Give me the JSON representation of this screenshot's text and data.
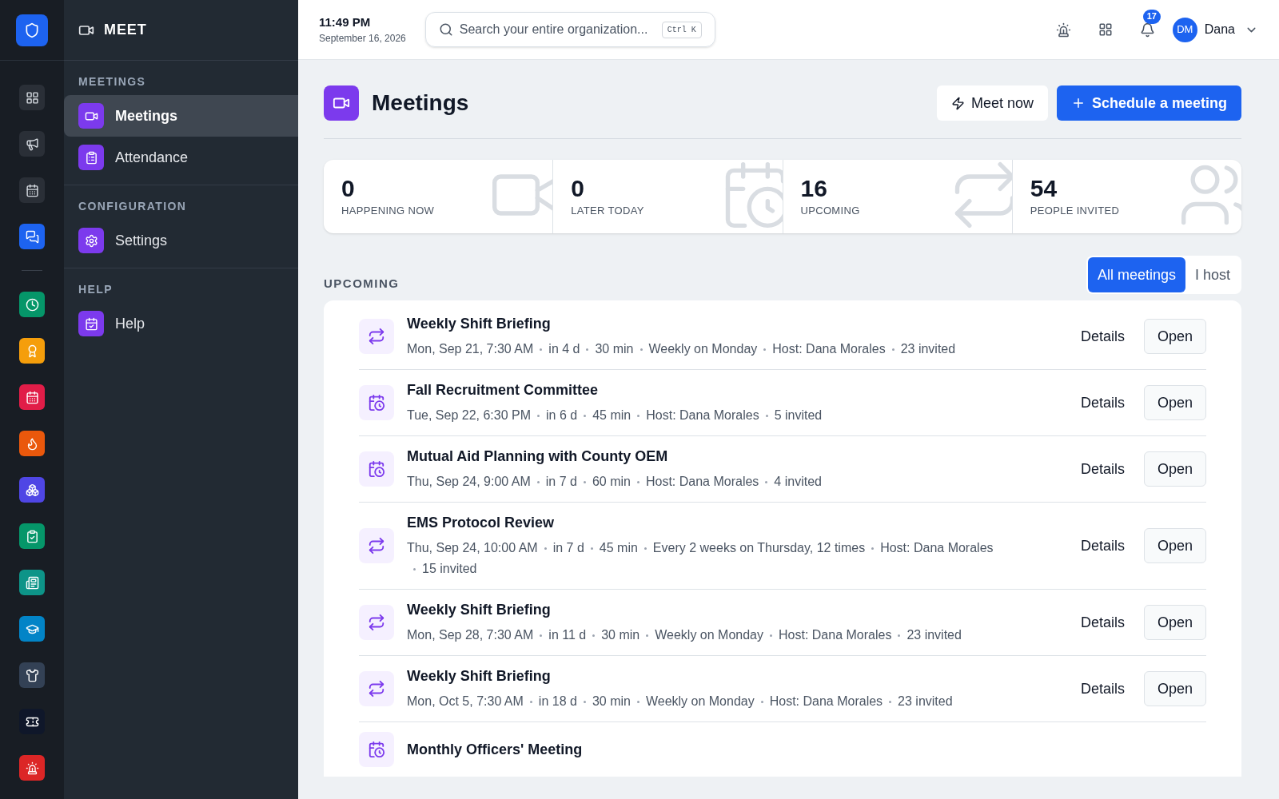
{
  "rail": {
    "top": [
      {
        "kind": "grid",
        "selected": false
      },
      {
        "kind": "megaphone",
        "selected": false
      },
      {
        "kind": "calendar",
        "selected": false
      },
      {
        "kind": "chat",
        "selected": true
      }
    ],
    "apps": [
      {
        "kind": "clock",
        "color": "#059669"
      },
      {
        "kind": "award",
        "color": "#f59e0b"
      },
      {
        "kind": "calendar",
        "color": "#e11d48"
      },
      {
        "kind": "flame",
        "color": "#ea580c"
      },
      {
        "kind": "boxes",
        "color": "#4f46e5"
      },
      {
        "kind": "clipboard",
        "color": "#059669"
      },
      {
        "kind": "newspaper",
        "color": "#0d9488"
      },
      {
        "kind": "cap",
        "color": "#0284c7"
      },
      {
        "kind": "shirt",
        "color": "#334155"
      },
      {
        "kind": "ticket",
        "color": "#0f172a"
      },
      {
        "kind": "siren",
        "color": "#dc2626"
      }
    ]
  },
  "sidebar": {
    "title": "MEET",
    "sections": [
      {
        "heading": "MEETINGS",
        "items": [
          {
            "label": "Meetings",
            "kind": "video",
            "selected": true
          },
          {
            "label": "Attendance",
            "kind": "clipboard",
            "selected": false
          }
        ]
      },
      {
        "heading": "CONFIGURATION",
        "items": [
          {
            "label": "Settings",
            "kind": "settings",
            "selected": false
          }
        ]
      },
      {
        "heading": "HELP",
        "items": [
          {
            "label": "Help",
            "kind": "calendar",
            "selected": false
          }
        ]
      }
    ]
  },
  "header": {
    "time": "11:49 PM",
    "date": "September 16, 2026",
    "search": {
      "placeholder": "Search your entire organization...",
      "shortcut": "Ctrl K"
    },
    "notifications": "17",
    "avatar": "DM",
    "user": "Dana"
  },
  "page": {
    "title": "Meetings",
    "buttons": [
      {
        "label": "Meet now",
        "kind": "secondary"
      },
      {
        "label": "Schedule a meeting",
        "kind": "primary"
      }
    ]
  },
  "stats": [
    {
      "value": "0",
      "label": "HAPPENING NOW",
      "kind": "video"
    },
    {
      "value": "0",
      "label": "LATER TODAY",
      "kind": "calendar"
    },
    {
      "value": "16",
      "label": "UPCOMING",
      "kind": "repeat"
    },
    {
      "value": "54",
      "label": "PEOPLE INVITED",
      "kind": "users"
    }
  ],
  "section": {
    "heading": "UPCOMING",
    "filters": [
      {
        "label": "All meetings",
        "selected": true
      },
      {
        "label": "I host",
        "selected": false
      }
    ]
  },
  "meetings": [
    {
      "title": "Weekly Shift Briefing",
      "kind": "recurring",
      "meta": [
        "Mon, Sep 21, 7:30 AM",
        "in 4 d",
        "30 min",
        "Weekly on Monday",
        "Host: Dana Morales",
        "23 invited"
      ],
      "actions": [
        "Details",
        "Open"
      ]
    },
    {
      "title": "Fall Recruitment Committee",
      "kind": "single",
      "meta": [
        "Tue, Sep 22, 6:30 PM",
        "in 6 d",
        "45 min",
        "Host: Dana Morales",
        "5 invited"
      ],
      "actions": [
        "Details",
        "Open"
      ]
    },
    {
      "title": "Mutual Aid Planning with County OEM",
      "kind": "single",
      "meta": [
        "Thu, Sep 24, 9:00 AM",
        "in 7 d",
        "60 min",
        "Host: Dana Morales",
        "4 invited"
      ],
      "actions": [
        "Details",
        "Open"
      ]
    },
    {
      "title": "EMS Protocol Review",
      "kind": "recurring",
      "meta": [
        "Thu, Sep 24, 10:00 AM",
        "in 7 d",
        "45 min",
        "Every 2 weeks on Thursday, 12 times",
        "Host: Dana Morales",
        "15 invited"
      ],
      "actions": [
        "Details",
        "Open"
      ]
    },
    {
      "title": "Weekly Shift Briefing",
      "kind": "recurring",
      "meta": [
        "Mon, Sep 28, 7:30 AM",
        "in 11 d",
        "30 min",
        "Weekly on Monday",
        "Host: Dana Morales",
        "23 invited"
      ],
      "actions": [
        "Details",
        "Open"
      ]
    },
    {
      "title": "Weekly Shift Briefing",
      "kind": "recurring",
      "meta": [
        "Mon, Oct 5, 7:30 AM",
        "in 18 d",
        "30 min",
        "Weekly on Monday",
        "Host: Dana Morales",
        "23 invited"
      ],
      "actions": [
        "Details",
        "Open"
      ]
    },
    {
      "title": "Monthly Officers' Meeting",
      "kind": "single"
    }
  ]
}
